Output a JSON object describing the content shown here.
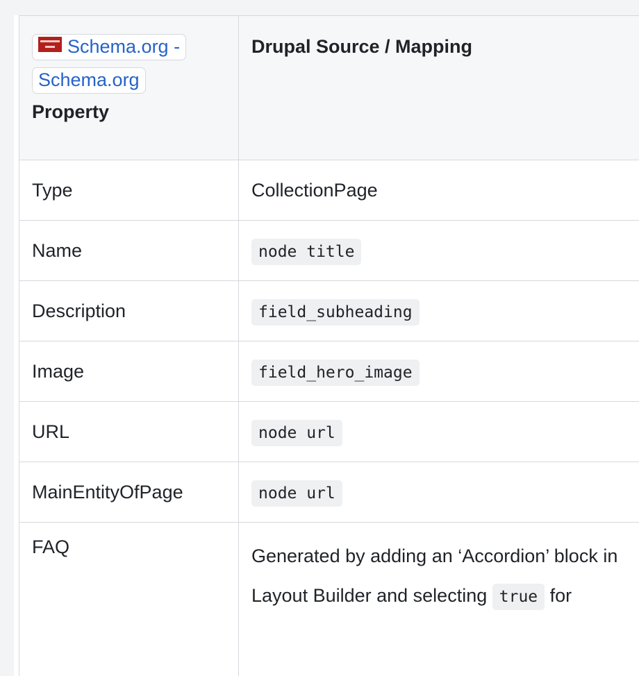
{
  "header": {
    "link_text": "Schema.org - Schema.org",
    "favicon_text": "schema .org",
    "property_label": "Property",
    "source_label": "Drupal Source / Mapping"
  },
  "rows": [
    {
      "property": "Type",
      "mapping": "CollectionPage",
      "is_code": false
    },
    {
      "property": "Name",
      "mapping": "node title",
      "is_code": true
    },
    {
      "property": "Description",
      "mapping": "field_subheading",
      "is_code": true
    },
    {
      "property": "Image",
      "mapping": "field_hero_image",
      "is_code": true
    },
    {
      "property": "URL",
      "mapping": "node url",
      "is_code": true
    },
    {
      "property": "MainEntityOfPage",
      "mapping": "node url",
      "is_code": true
    }
  ],
  "faq": {
    "property": "FAQ",
    "text": "Generated by adding an ‘Accordion’ block in Layout Builder and selecting",
    "code": "true",
    "suffix": "for"
  },
  "colors": {
    "link": "#2563c9",
    "border": "#d5d8dc",
    "header_bg": "#f6f7f8",
    "code_bg": "#eef0f2",
    "favicon": "#b3201c"
  }
}
